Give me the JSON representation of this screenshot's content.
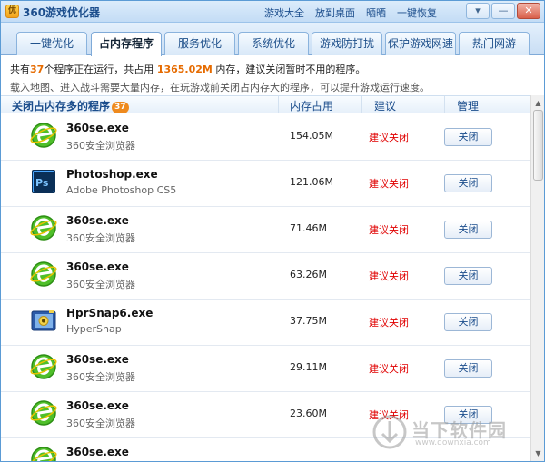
{
  "app": {
    "logo_text": "优",
    "title": "360游戏优化器",
    "title_links": [
      "游戏大全",
      "放到桌面",
      "晒晒",
      "一键恢复"
    ],
    "window_buttons": [
      "▾",
      "—",
      "✕"
    ]
  },
  "tabs": [
    {
      "label": "一键优化",
      "active": false
    },
    {
      "label": "占内存程序",
      "active": true
    },
    {
      "label": "服务优化",
      "active": false
    },
    {
      "label": "系统优化",
      "active": false
    },
    {
      "label": "游戏防打扰",
      "active": false
    },
    {
      "label": "保护游戏网速",
      "active": false
    },
    {
      "label": "热门网游",
      "active": false
    }
  ],
  "info": {
    "prefix": "共有",
    "count": "37",
    "mid": "个程序正在运行，共占用",
    "total_mem": "1365.02M",
    "suffix": "内存，建议关闭暂时不用的程序。",
    "line2": "载入地图、进入战斗需要大量内存，在玩游戏前关闭占内存大的程序，可以提升游戏运行速度。"
  },
  "columns": {
    "title": "关闭占内存多的程序",
    "badge": "37",
    "memory": "内存占用",
    "advice": "建议",
    "manage": "管理"
  },
  "processes": [
    {
      "name": "360se.exe",
      "desc": "360安全浏览器",
      "memory": "154.05M",
      "advice": "建议关闭",
      "action": "关闭",
      "icon": "360-browser-icon"
    },
    {
      "name": "Photoshop.exe",
      "desc": "Adobe Photoshop CS5",
      "memory": "121.06M",
      "advice": "建议关闭",
      "action": "关闭",
      "icon": "photoshop-icon"
    },
    {
      "name": "360se.exe",
      "desc": "360安全浏览器",
      "memory": "71.46M",
      "advice": "建议关闭",
      "action": "关闭",
      "icon": "360-browser-icon"
    },
    {
      "name": "360se.exe",
      "desc": "360安全浏览器",
      "memory": "63.26M",
      "advice": "建议关闭",
      "action": "关闭",
      "icon": "360-browser-icon"
    },
    {
      "name": "HprSnap6.exe",
      "desc": "HyperSnap",
      "memory": "37.75M",
      "advice": "建议关闭",
      "action": "关闭",
      "icon": "hypersnap-icon"
    },
    {
      "name": "360se.exe",
      "desc": "360安全浏览器",
      "memory": "29.11M",
      "advice": "建议关闭",
      "action": "关闭",
      "icon": "360-browser-icon"
    },
    {
      "name": "360se.exe",
      "desc": "360安全浏览器",
      "memory": "23.60M",
      "advice": "建议关闭",
      "action": "关闭",
      "icon": "360-browser-icon"
    },
    {
      "name": "360se.exe",
      "desc": "",
      "memory": "",
      "advice": "",
      "action": "",
      "icon": "360-browser-icon"
    }
  ],
  "watermark": {
    "text": "当下软件园",
    "url": "www.downxia.com"
  },
  "colors": {
    "accent": "#1b4d8c",
    "highlight": "#e66b00",
    "advice_red": "#e00000",
    "badge": "#ee8a1e"
  }
}
